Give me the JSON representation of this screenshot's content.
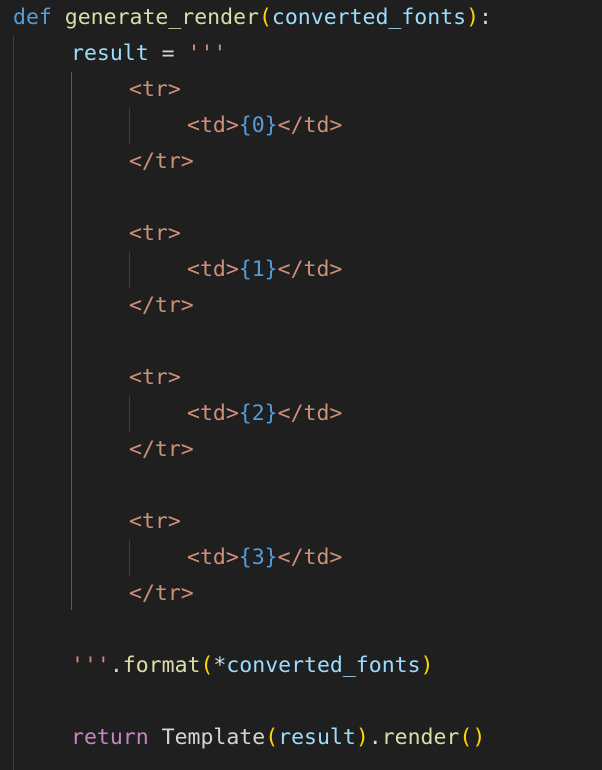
{
  "code": {
    "def_kw": "def",
    "func_name": "generate_render",
    "paren_open": "(",
    "param": "converted_fonts",
    "paren_close": ")",
    "colon": ":",
    "result_var": "result",
    "assign": " = ",
    "triple_quote": "'''",
    "tr_open": "<tr>",
    "tr_close": "</tr>",
    "td_open": "<td>",
    "td_close": "</td>",
    "placeholders": [
      "{0}",
      "{1}",
      "{2}",
      "{3}"
    ],
    "format_dot": ".format",
    "star": "*",
    "format_arg": "converted_fonts",
    "return_kw": "return",
    "template_cls": "Template",
    "result_arg": "result",
    "render_call": ".render",
    "empty_parens": "()"
  },
  "colors": {
    "background": "#1f1f1f",
    "keyword": "#569cd6",
    "control": "#c586c0",
    "function": "#dcdcaa",
    "variable": "#9cdcfe",
    "string": "#ce9178",
    "bracket": "#ffd700"
  }
}
